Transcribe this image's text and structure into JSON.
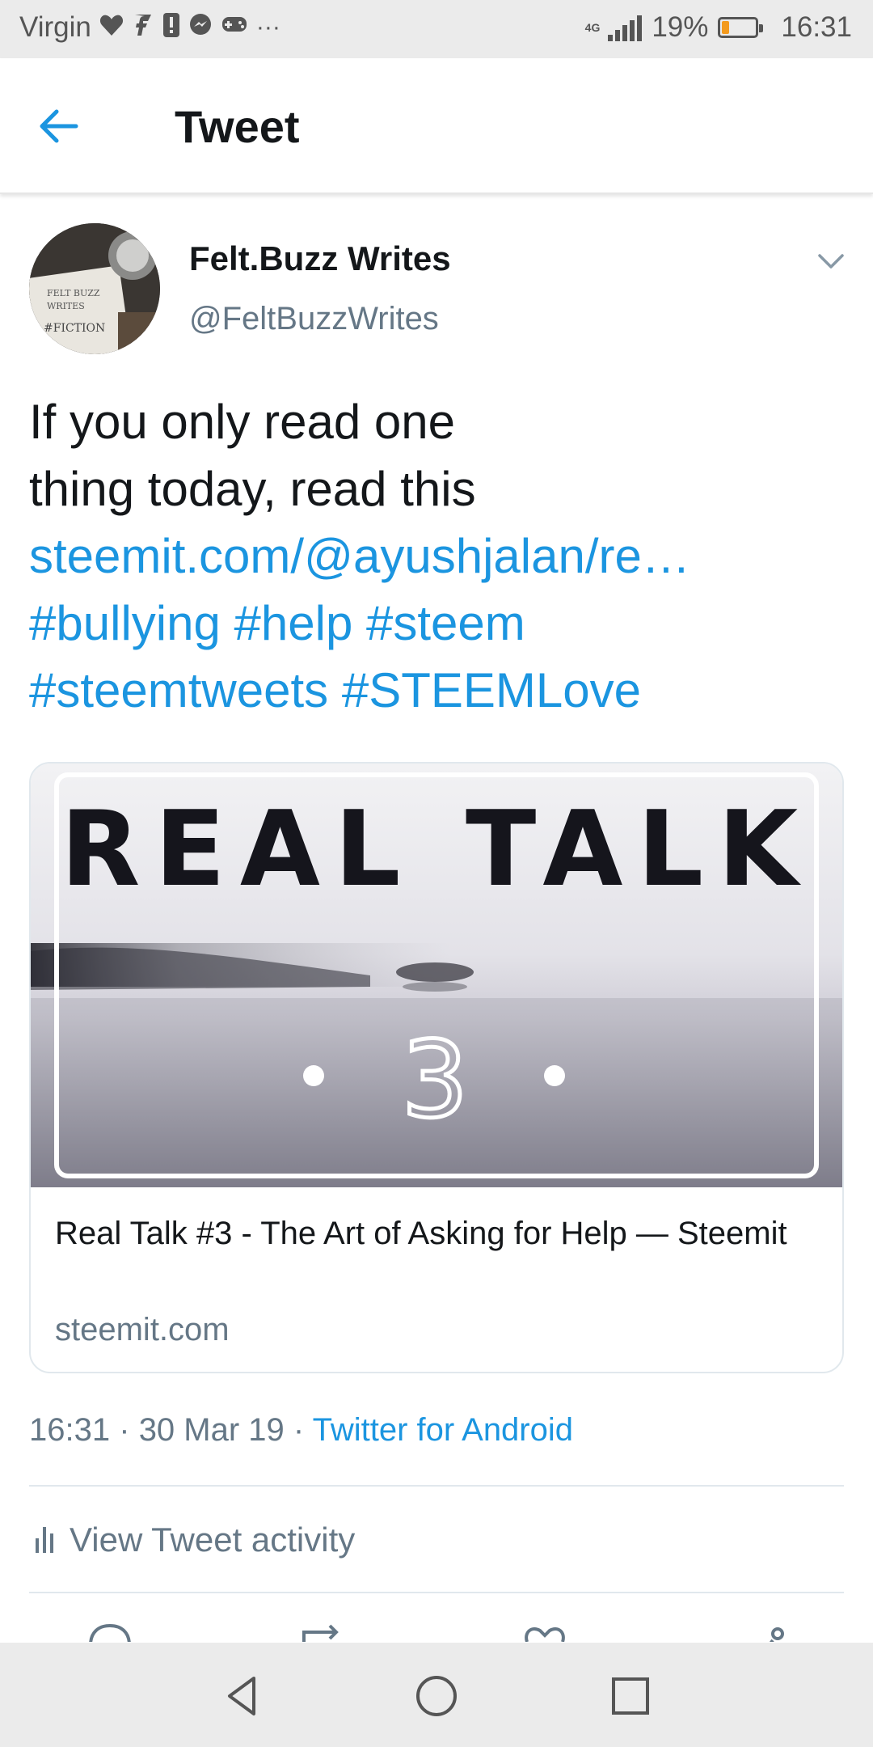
{
  "status_bar": {
    "carrier": "Virgin",
    "notification_icons": [
      "heart-icon",
      "facebook-icon",
      "alert-icon",
      "messenger-icon",
      "gamepad-icon",
      "more-icon"
    ],
    "more_glyph": "···",
    "network": "4G",
    "battery_percent": "19%",
    "battery_level": 0.19,
    "battery_color": "#f39a1d",
    "time": "16:31"
  },
  "app_bar": {
    "title": "Tweet",
    "back_icon": "arrow-left-icon"
  },
  "tweet": {
    "author_name": "Felt.Buzz Writes",
    "author_handle": "@FeltBuzzWrites",
    "avatar_text_lines": [
      "FELT BUZZ",
      "WRITES",
      "#FICTION"
    ],
    "text_line_1": "If you only read one",
    "text_line_2": "thing today, read this",
    "link": "steemit.com/@ayushjalan/re…",
    "hashtags_line_1": "#bullying #help #steem",
    "hashtags_line_2": "#steemtweets #STEEMLove",
    "card": {
      "image_heading": "REAL TALK",
      "image_number": "3",
      "title": "Real Talk #3 - The Art of Asking for Help — Steemit",
      "domain": "steemit.com"
    },
    "time": "16:31",
    "date": "30 Mar 19",
    "separator": "·",
    "source": "Twitter for Android",
    "activity_label": "View Tweet activity"
  },
  "actions": [
    "reply-icon",
    "retweet-icon",
    "like-icon",
    "share-icon"
  ],
  "nav_bar": [
    "back-triangle-icon",
    "home-circle-icon",
    "recents-square-icon"
  ],
  "colors": {
    "accent": "#1b95e0",
    "secondary_text": "#657786",
    "status_bar_bg": "#ebebeb"
  }
}
